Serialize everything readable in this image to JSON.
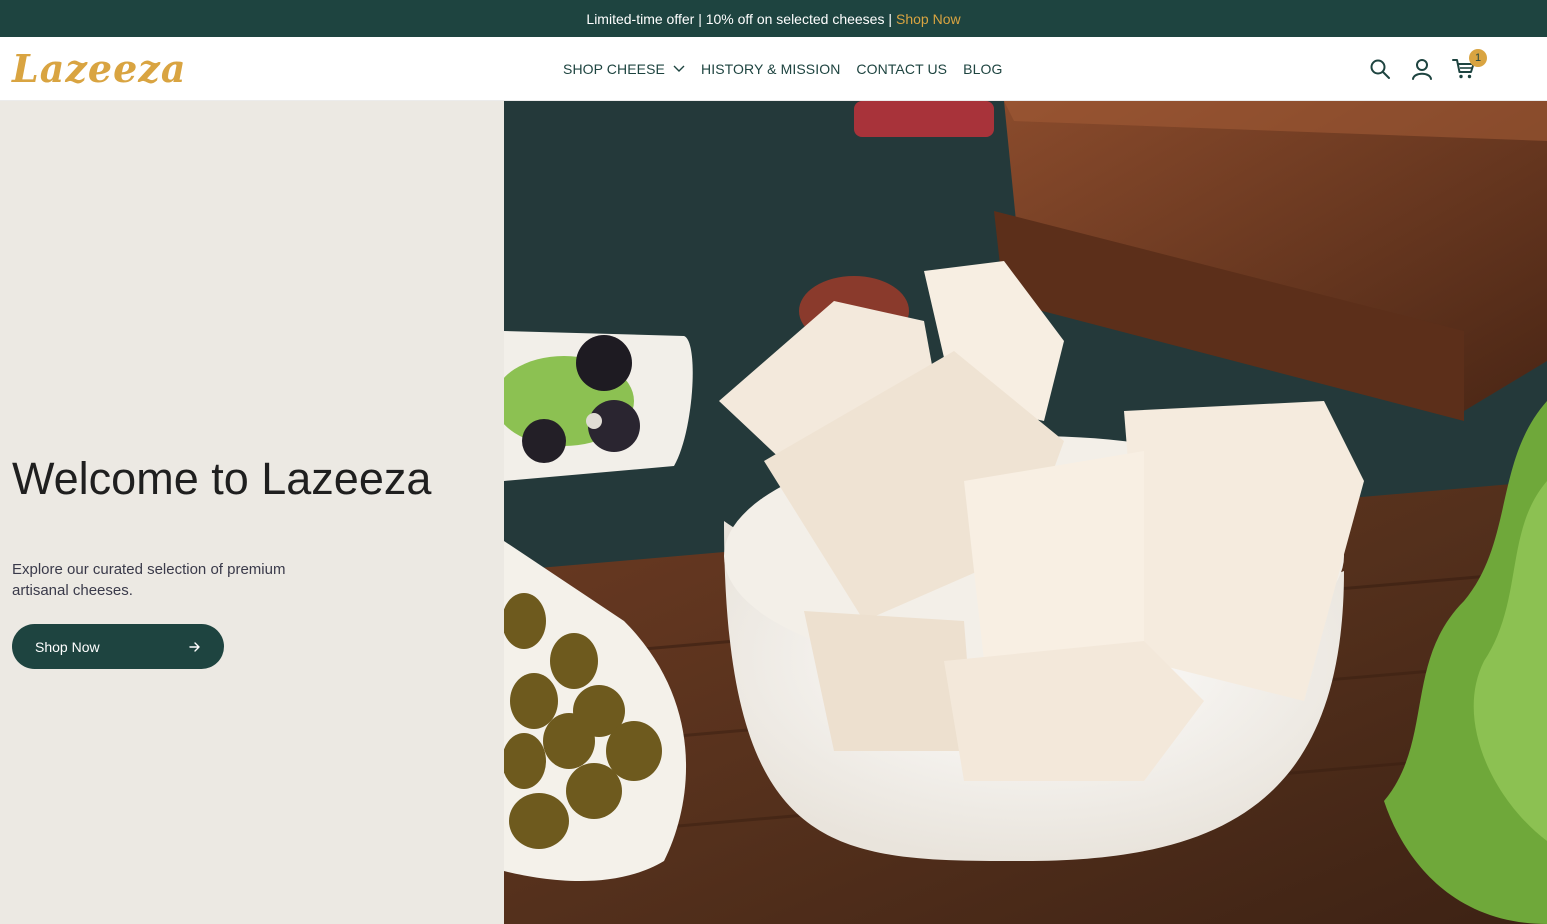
{
  "announcement": {
    "text": "Limited-time offer | 10% off on selected cheeses |",
    "link": "Shop Now"
  },
  "header": {
    "logo": "Lazeeza",
    "nav": [
      {
        "label": "SHOP CHEESE",
        "has_dropdown": true
      },
      {
        "label": "HISTORY & MISSION"
      },
      {
        "label": "CONTACT US"
      },
      {
        "label": "BLOG"
      }
    ],
    "icons": [
      "search-icon",
      "account-icon",
      "cart-icon"
    ],
    "cart_count": "1"
  },
  "hero": {
    "title": "Welcome to Lazeeza",
    "subtitle": "Explore our curated selection of premium artisanal cheeses.",
    "cta": "Shop Now",
    "image": "white-cheese-bowl-photo"
  },
  "colors": {
    "brand_dark": "#1e4440",
    "brand_gold": "#d9a441",
    "hero_bg": "#ece9e3"
  }
}
